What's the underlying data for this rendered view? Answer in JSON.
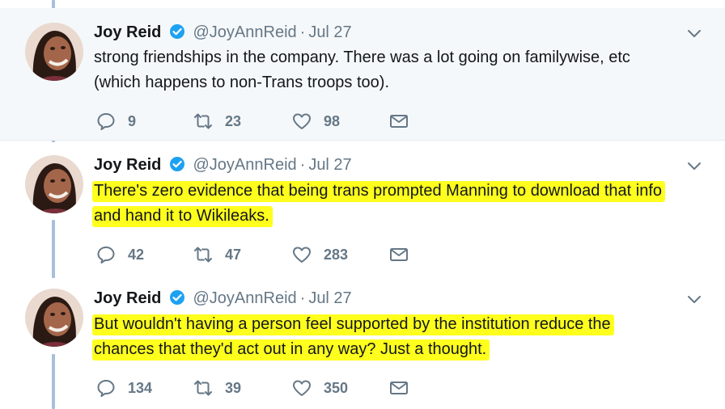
{
  "tweets": [
    {
      "name": "Joy Reid",
      "handle": "@JoyAnnReid",
      "separator": "·",
      "date": "Jul 27",
      "lines": [
        "strong friendships in the company. There was a lot going on familywise, etc",
        "(which happens to non-Trans troops too)."
      ],
      "highlighted": false,
      "replies": "9",
      "retweets": "23",
      "likes": "98"
    },
    {
      "name": "Joy Reid",
      "handle": "@JoyAnnReid",
      "separator": "·",
      "date": "Jul 27",
      "lines": [
        "There's zero evidence that being trans prompted Manning to download that info",
        "and hand it to Wikileaks."
      ],
      "highlighted": true,
      "replies": "42",
      "retweets": "47",
      "likes": "283"
    },
    {
      "name": "Joy Reid",
      "handle": "@JoyAnnReid",
      "separator": "·",
      "date": "Jul 27",
      "lines": [
        "But wouldn't having a person feel supported by the institution reduce the",
        "chances that they'd act out in any way? Just a thought."
      ],
      "highlighted": true,
      "replies": "134",
      "retweets": "39",
      "likes": "350"
    }
  ],
  "icons": {
    "verified": "verified-badge-icon",
    "caret": "chevron-down-icon",
    "reply": "reply-icon",
    "retweet": "retweet-icon",
    "like": "heart-icon",
    "dm": "envelope-icon"
  },
  "colors": {
    "highlight": "#ffff1e",
    "thread_line": "#a7bfd9",
    "verified": "#1da1f2",
    "secondary_text": "#657786",
    "first_tweet_bg": "#f5f8fa"
  }
}
